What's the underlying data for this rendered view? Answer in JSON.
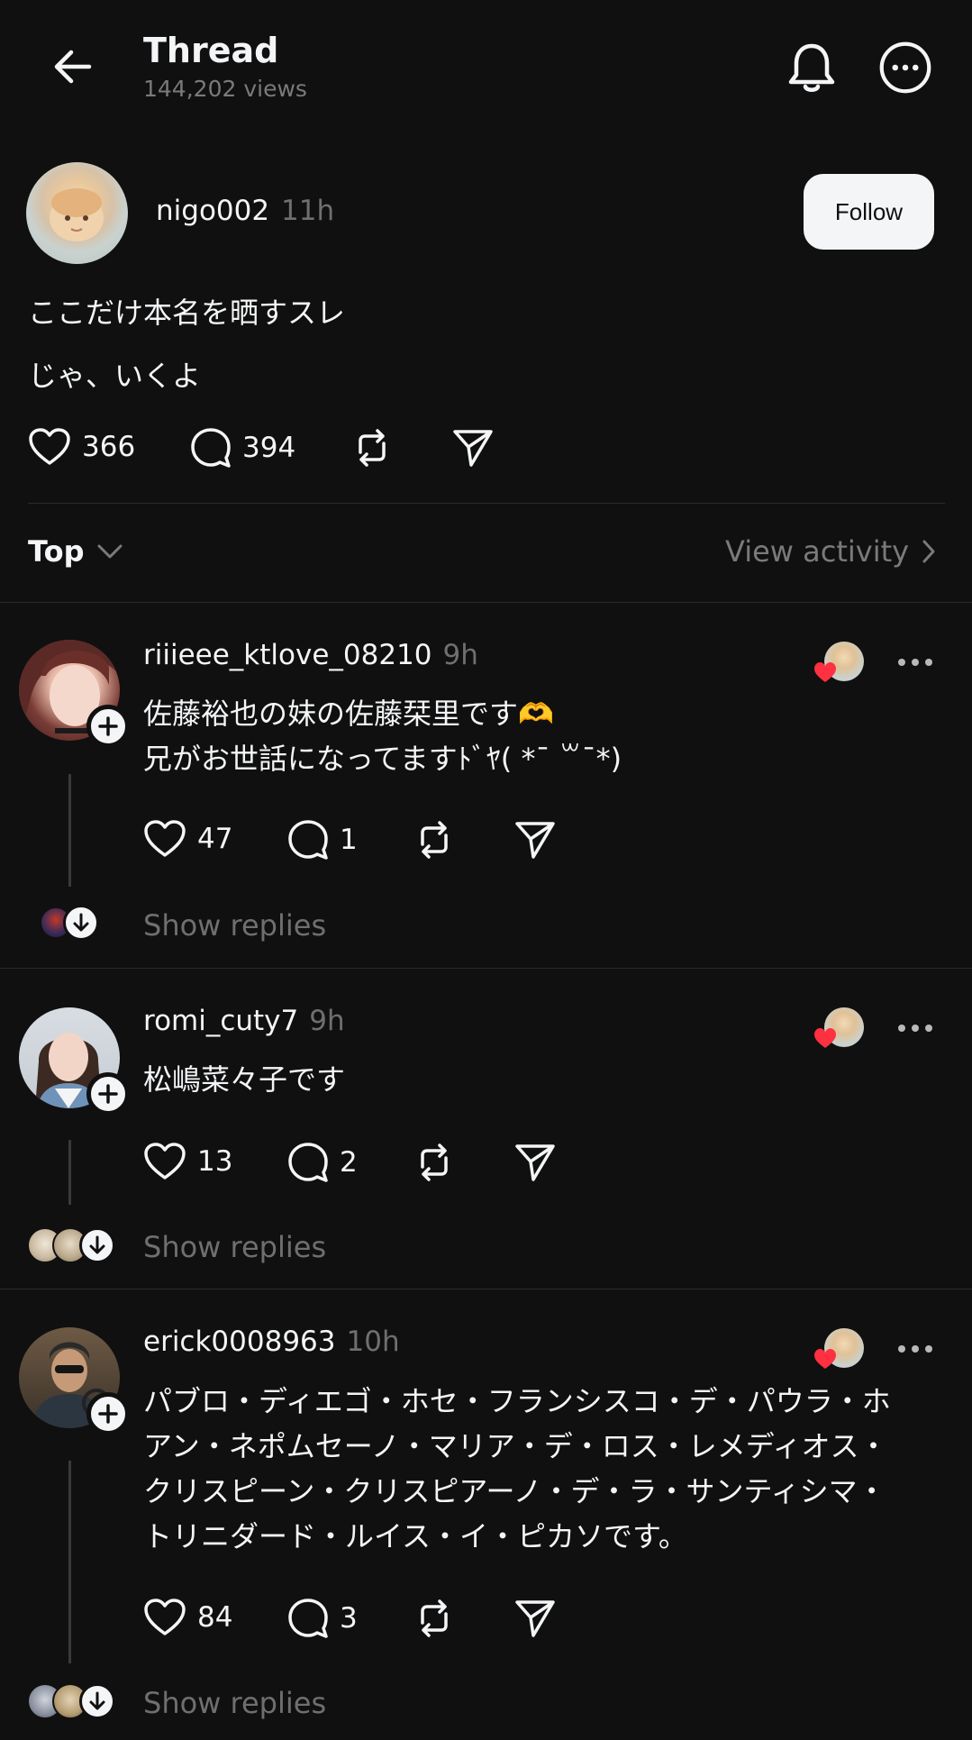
{
  "header": {
    "title": "Thread",
    "views": "144,202 views"
  },
  "post": {
    "username": "nigo002",
    "time": "11h",
    "follow_label": "Follow",
    "lines": [
      "ここだけ本名を晒すスレ",
      "じゃ、いくよ"
    ],
    "likes": "366",
    "comments": "394"
  },
  "sort": {
    "label": "Top",
    "view_activity": "View activity"
  },
  "replies": [
    {
      "username": "riiieee_ktlove_08210",
      "time": "9h",
      "text": "佐藤裕也の妹の佐藤栞里です🫶\n兄がお世話になってますﾄﾞﾔ( *¯ ꒳¯*)",
      "likes": "47",
      "comments": "1",
      "show_replies": "Show replies"
    },
    {
      "username": "romi_cuty7",
      "time": "9h",
      "text": "松嶋菜々子です",
      "likes": "13",
      "comments": "2",
      "show_replies": "Show replies"
    },
    {
      "username": "erick0008963",
      "time": "10h",
      "text": "パブロ・ディエゴ・ホセ・フランシスコ・デ・パウラ・ホ\nアン・ネポムセーノ・マリア・デ・ロス・レメディオス・\nクリスピーン・クリスピアーノ・デ・ラ・サンティシマ・\nトリニダード・ルイス・イ・ピカソです。",
      "likes": "84",
      "comments": "3",
      "show_replies": "Show replies"
    }
  ],
  "colors": {
    "background": "#101010",
    "text": "#f3f5f7",
    "muted": "#7a7a7a",
    "like_red": "#ff3040"
  },
  "icons": [
    "back-arrow-icon",
    "bell-icon",
    "more-circle-icon",
    "heart-icon",
    "comment-icon",
    "repost-icon",
    "share-icon",
    "chevron-down-icon",
    "chevron-right-icon",
    "plus-icon",
    "arrow-down-icon"
  ]
}
